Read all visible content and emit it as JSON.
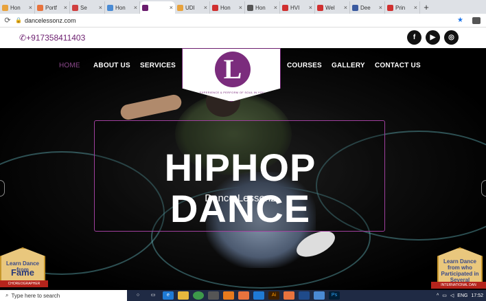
{
  "browser": {
    "tabs": [
      {
        "title": "Hon",
        "color": "#e8a33d"
      },
      {
        "title": "Portf",
        "color": "#e8733d"
      },
      {
        "title": "Se",
        "color": "#d04040"
      },
      {
        "title": "Hon",
        "color": "#4a8bd4"
      },
      {
        "title": "",
        "color": "#6b1d6e",
        "active": true
      },
      {
        "title": "UDI",
        "color": "#e8a33d"
      },
      {
        "title": "Hon",
        "color": "#d03030"
      },
      {
        "title": "Hon",
        "color": "#555555"
      },
      {
        "title": "HVI",
        "color": "#d03030"
      },
      {
        "title": "Wel",
        "color": "#d03030"
      },
      {
        "title": "Dee",
        "color": "#3a5aa0"
      },
      {
        "title": "Prin",
        "color": "#d03030"
      }
    ],
    "new_tab": "+",
    "url": "dancelessonz.com"
  },
  "site": {
    "phone": "+917358411403",
    "social": [
      "f",
      "▶",
      "◎"
    ],
    "nav": {
      "home": "HOME",
      "about": "ABOUT US",
      "services": "SERVICES",
      "courses": "COURSES",
      "gallery": "GALLERY",
      "contact": "CONTACT US"
    },
    "logo": {
      "letter": "L",
      "tagline": "EXPERIENCE & PERFORM OF SOUL IN YOU"
    },
    "hero": {
      "title": "HIPHOP DANCE",
      "subtitle": "Dance Lessonz"
    },
    "badge_left": {
      "line1": "Learn Dance from",
      "line2": "Fame",
      "ribbon": "CHOREOGRAPHER"
    },
    "badge_right": {
      "line1": "Learn Dance from who Participated in Several",
      "ribbon": "INTERNATIONAL DAN"
    }
  },
  "taskbar": {
    "search_placeholder": "Type here to search",
    "lang": "ENG",
    "time": "17:52"
  },
  "colors": {
    "brand": "#6b1d6e",
    "hero_border": "#a0409e"
  }
}
